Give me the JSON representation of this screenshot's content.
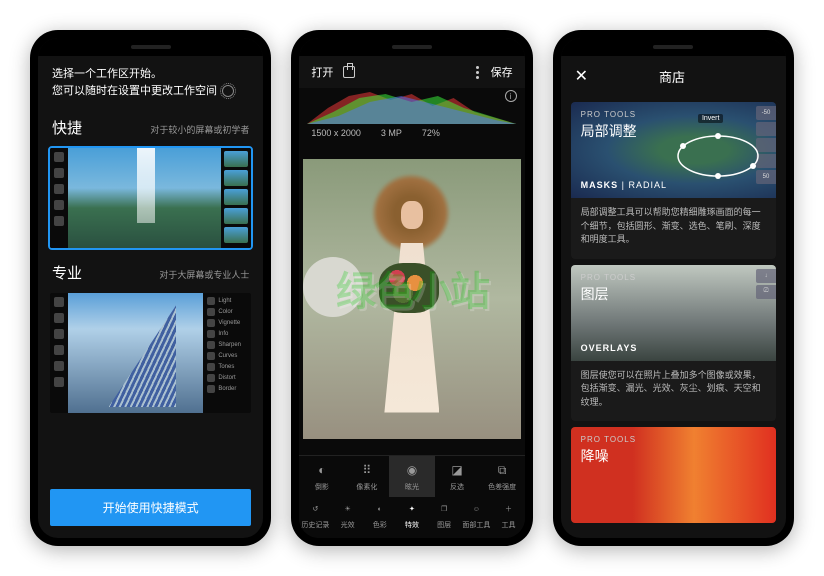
{
  "phone1": {
    "header_line1": "选择一个工作区开始。",
    "header_line2": "您可以随时在设置中更改工作空间",
    "quick": {
      "title": "快捷",
      "subtitle": "对于较小的屏幕或初学者"
    },
    "pro": {
      "title": "专业",
      "subtitle": "对于大屏幕或专业人士"
    },
    "pro_tools": [
      "Light",
      "Color",
      "Vignette",
      "Info",
      "Sharpen",
      "Curves",
      "Tones",
      "Distort",
      "Border"
    ],
    "cta": "开始使用快捷模式"
  },
  "phone2": {
    "open": "打开",
    "save": "保存",
    "dims": "1500 x 2000",
    "mp": "3 MP",
    "pct": "72%",
    "fx": [
      {
        "label": "倒影"
      },
      {
        "label": "像素化"
      },
      {
        "label": "眩光"
      },
      {
        "label": "反选"
      },
      {
        "label": "色差强度"
      }
    ],
    "tools": [
      {
        "label": "历史记录"
      },
      {
        "label": "光效"
      },
      {
        "label": "色彩"
      },
      {
        "label": "特效"
      },
      {
        "label": "图层"
      },
      {
        "label": "面部工具"
      },
      {
        "label": "工具"
      }
    ]
  },
  "phone3": {
    "title": "商店",
    "cards": [
      {
        "top": "PRO TOOLS",
        "main": "局部调整",
        "bot_bold": "MASKS",
        "bot_light": "RADIAL",
        "chips": [
          "-50",
          "",
          "",
          "",
          "50"
        ],
        "annot": "Invert",
        "desc": "局部调整工具可以帮助您精细雕琢画面的每一个细节，包括圆形、渐变、选色、笔刷、深度和明度工具。"
      },
      {
        "top": "PRO TOOLS",
        "main": "图层",
        "bot_bold": "OVERLAYS",
        "bot_light": "",
        "chips": [
          "",
          ""
        ],
        "desc": "图层使您可以在照片上叠加多个图像或效果，包括渐变、漏光、光效、灰尘、划痕、天空和纹理。"
      },
      {
        "top": "PRO TOOLS",
        "main": "降噪",
        "bot_bold": "",
        "bot_light": "",
        "chips": [],
        "desc": ""
      }
    ]
  },
  "watermark": "绿色小站"
}
